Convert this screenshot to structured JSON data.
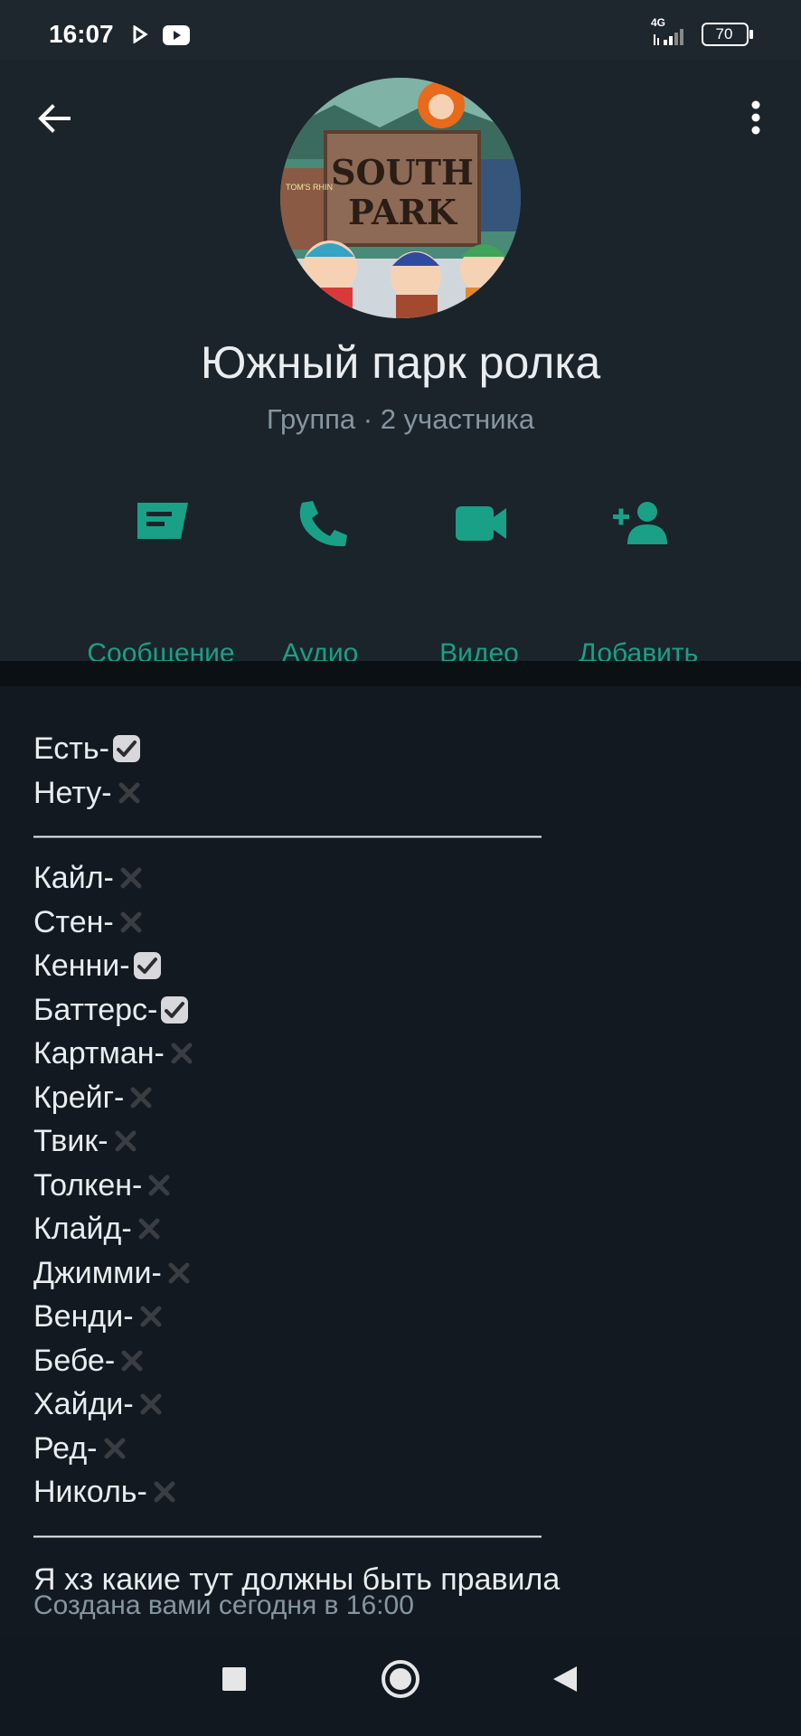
{
  "status_bar": {
    "time": "16:07",
    "network": "4G",
    "battery": "70",
    "icons": [
      "cast-icon",
      "youtube-icon",
      "signal-icon",
      "battery-icon"
    ]
  },
  "header": {
    "back_icon": "arrow-back-icon",
    "menu_icon": "more-vert-icon",
    "avatar_text_line1": "SOUTH",
    "avatar_text_line2": "PARK",
    "avatar_small_text": "TOM'S RHIN",
    "group_name": "Южный парк ролка",
    "group_sub": "Группа · 2 участника"
  },
  "actions": [
    {
      "label": "Сообщение",
      "icon": "message-icon"
    },
    {
      "label": "Аудио",
      "icon": "phone-icon"
    },
    {
      "label": "Видео",
      "icon": "video-icon"
    },
    {
      "label": "Добавить",
      "icon": "add-person-icon"
    }
  ],
  "description": {
    "legend": [
      {
        "text": "Есть-",
        "mark": "check"
      },
      {
        "text": "Нету-",
        "mark": "cross"
      }
    ],
    "separator": "————————————————————",
    "characters": [
      {
        "text": "Кайл-",
        "mark": "cross"
      },
      {
        "text": "Стен-",
        "mark": "cross"
      },
      {
        "text": "Кенни-",
        "mark": "check"
      },
      {
        "text": "Баттерс-",
        "mark": "check"
      },
      {
        "text": "Картман-",
        "mark": "cross"
      },
      {
        "text": "Крейг-",
        "mark": "cross"
      },
      {
        "text": "Твик-",
        "mark": "cross"
      },
      {
        "text": "Толкен-",
        "mark": "cross"
      },
      {
        "text": "Клайд-",
        "mark": "cross"
      },
      {
        "text": "Джимми-",
        "mark": "cross"
      },
      {
        "text": "Венди-",
        "mark": "cross"
      },
      {
        "text": "Бебе-",
        "mark": "cross"
      },
      {
        "text": "Хайди-",
        "mark": "cross"
      },
      {
        "text": "Ред-",
        "mark": "cross"
      },
      {
        "text": "Николь-",
        "mark": "cross"
      }
    ],
    "rules": "Я хз какие тут должны быть правила",
    "created": "Создана вами сегодня в 16:00"
  },
  "colors": {
    "accent": "#1aa087",
    "background": "#121921",
    "panel": "#1b232b",
    "secondary_text": "#8696a0"
  },
  "nav": {
    "icons": [
      "recents-square-icon",
      "home-circle-icon",
      "back-triangle-icon"
    ]
  }
}
